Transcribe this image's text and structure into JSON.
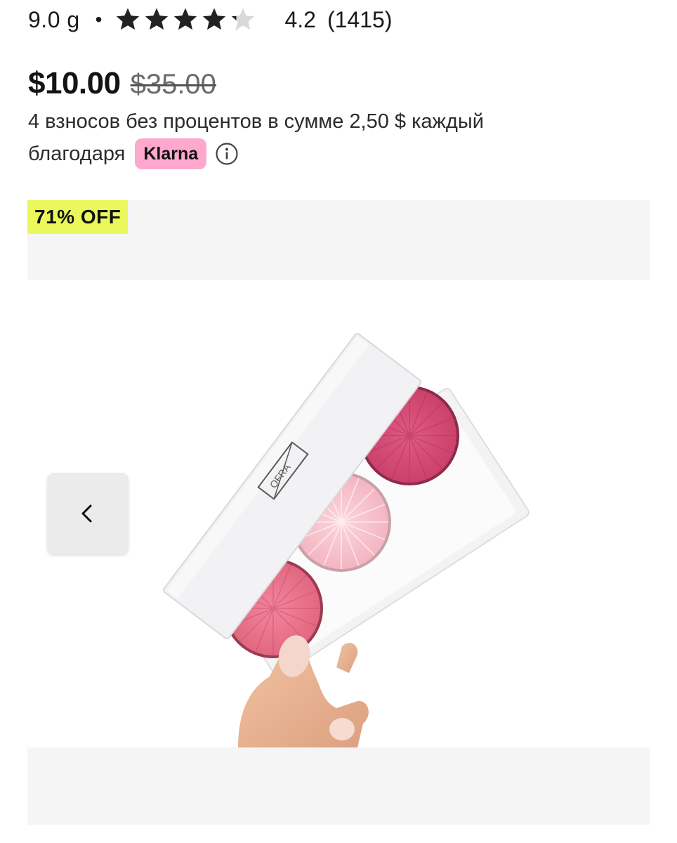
{
  "product": {
    "weight": "9.0 g",
    "separator": "•",
    "rating": "4.2",
    "review_count": "(1415)",
    "stars_filled": 4.2,
    "stars_total": 5
  },
  "pricing": {
    "price": "$10.00",
    "original_price": "$35.00",
    "installments_line1": "4 взносов без процентов в сумме 2,50 $ каждый",
    "installments_line2": "благодаря",
    "provider": "Klarna"
  },
  "gallery": {
    "badge": "71% OFF",
    "image_label": "OFRA"
  },
  "colors": {
    "badge_bg": "#eaf85c",
    "klarna_bg": "#ffa8cd",
    "star_filled": "#222222",
    "star_empty": "#d9d9d9"
  },
  "icons": {
    "info": "info-icon",
    "prev": "chevron-left-icon",
    "star": "star-icon"
  }
}
